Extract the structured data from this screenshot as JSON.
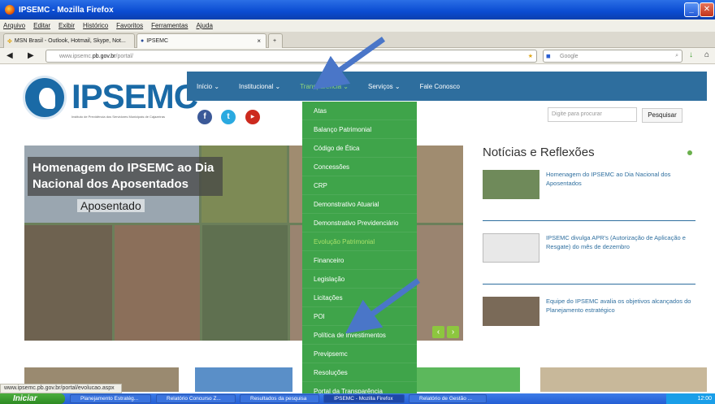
{
  "window": {
    "title": "IPSEMC - Mozilla Firefox"
  },
  "menubar": [
    "Arquivo",
    "Editar",
    "Exibir",
    "Histórico",
    "Favoritos",
    "Ferramentas",
    "Ajuda"
  ],
  "tabs": [
    {
      "label": "MSN Brasil - Outlook, Hotmail, Skype, Not...",
      "active": false
    },
    {
      "label": "IPSEMC",
      "active": true
    }
  ],
  "navbar": {
    "url_prefix": "www.ipsemc.",
    "url_domain": "pb.gov.br",
    "url_path": "/portal/",
    "search_placeholder": "Google"
  },
  "site": {
    "logo": "IPSEMC",
    "logo_sub": "Instituto de Previdência dos Servidores Municipais de Cajazeiras",
    "nav": [
      {
        "label": "Início ⌄",
        "active": false
      },
      {
        "label": "Institucional ⌄",
        "active": false
      },
      {
        "label": "Transparência ⌄",
        "active": true
      },
      {
        "label": "Serviços ⌄",
        "active": false
      },
      {
        "label": "Fale Conosco",
        "active": false
      }
    ],
    "search_placeholder": "Digite para procurar",
    "search_button": "Pesquisar",
    "dropdown": [
      "Atas",
      "Balanço Patrimonial",
      "Código de Ética",
      "Concessões",
      "CRP",
      "Demonstrativo Atuarial",
      "Demonstrativo Previdenciário",
      "Evolução Patrimonial",
      "Financeiro",
      "Legislação",
      "Licitações",
      "POI",
      "Política de Investimentos",
      "Previpsemc",
      "Resoluções",
      "Portal da Transparência"
    ],
    "dropdown_highlight": 7,
    "slide": {
      "title": "Homenagem do IPSEMC ao Dia Nacional dos Aposentados",
      "subtitle": "Aposentado"
    },
    "news_title": "Notícias e Reflexões",
    "news": [
      "Homenagem do IPSEMC ao Dia Nacional dos Aposentados",
      "IPSEMC divulga APR's (Autorização de Aplicação e Resgate) do mês de dezembro",
      "Equipe do IPSEMC avalia os objetivos alcançados do Planejamento estratégico"
    ]
  },
  "statusbar": "www.ipsemc.pb.gov.br/portal/evolucao.aspx",
  "taskbar": {
    "start": "Iniciar",
    "tasks": [
      {
        "label": "Planejamento Estratég...",
        "active": false
      },
      {
        "label": "Relatório Concurso Z...",
        "active": false
      },
      {
        "label": "Resultados da pesquisa",
        "active": false
      },
      {
        "label": "IPSEMC - Mozilla Firefox",
        "active": true
      },
      {
        "label": "Relatório de Gestão ...",
        "active": false
      }
    ],
    "clock": "12:00"
  },
  "colors": {
    "nav_blue": "#2e6e9e",
    "dropdown_green": "#3fa44a",
    "highlight_green": "#a8e06a"
  }
}
